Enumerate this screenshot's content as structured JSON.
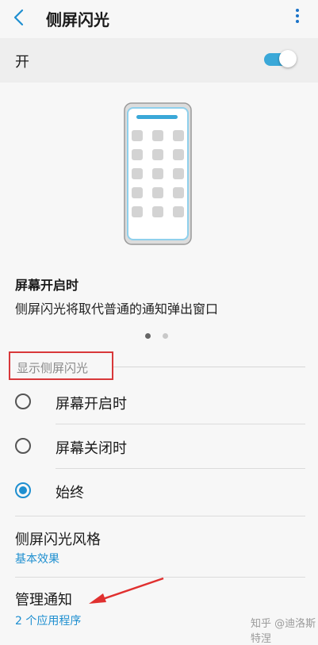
{
  "header": {
    "title": "侧屏闪光",
    "back_icon": "chevron-left-icon",
    "more_icon": "more-vertical-icon"
  },
  "master_switch": {
    "label": "开",
    "on": true,
    "color": "#3aa8d8"
  },
  "preview": {
    "caption_title": "屏幕开启时",
    "caption_desc": "侧屏闪光将取代普通的通知弹出窗口",
    "page_count": 2,
    "current_page": 1
  },
  "display_section": {
    "label": "显示侧屏闪光",
    "options": [
      {
        "label": "屏幕开启时",
        "selected": false
      },
      {
        "label": "屏幕关闭时",
        "selected": false
      },
      {
        "label": "始终",
        "selected": true
      }
    ]
  },
  "style_setting": {
    "title": "侧屏闪光风格",
    "value": "基本效果"
  },
  "notifications": {
    "title": "管理通知",
    "value": "2 个应用程序"
  },
  "watermark": "知乎 @迪洛斯特涅",
  "colors": {
    "accent": "#1e8fd0",
    "highlight_box": "#d8383a",
    "annotation_arrow": "#e0302f"
  }
}
